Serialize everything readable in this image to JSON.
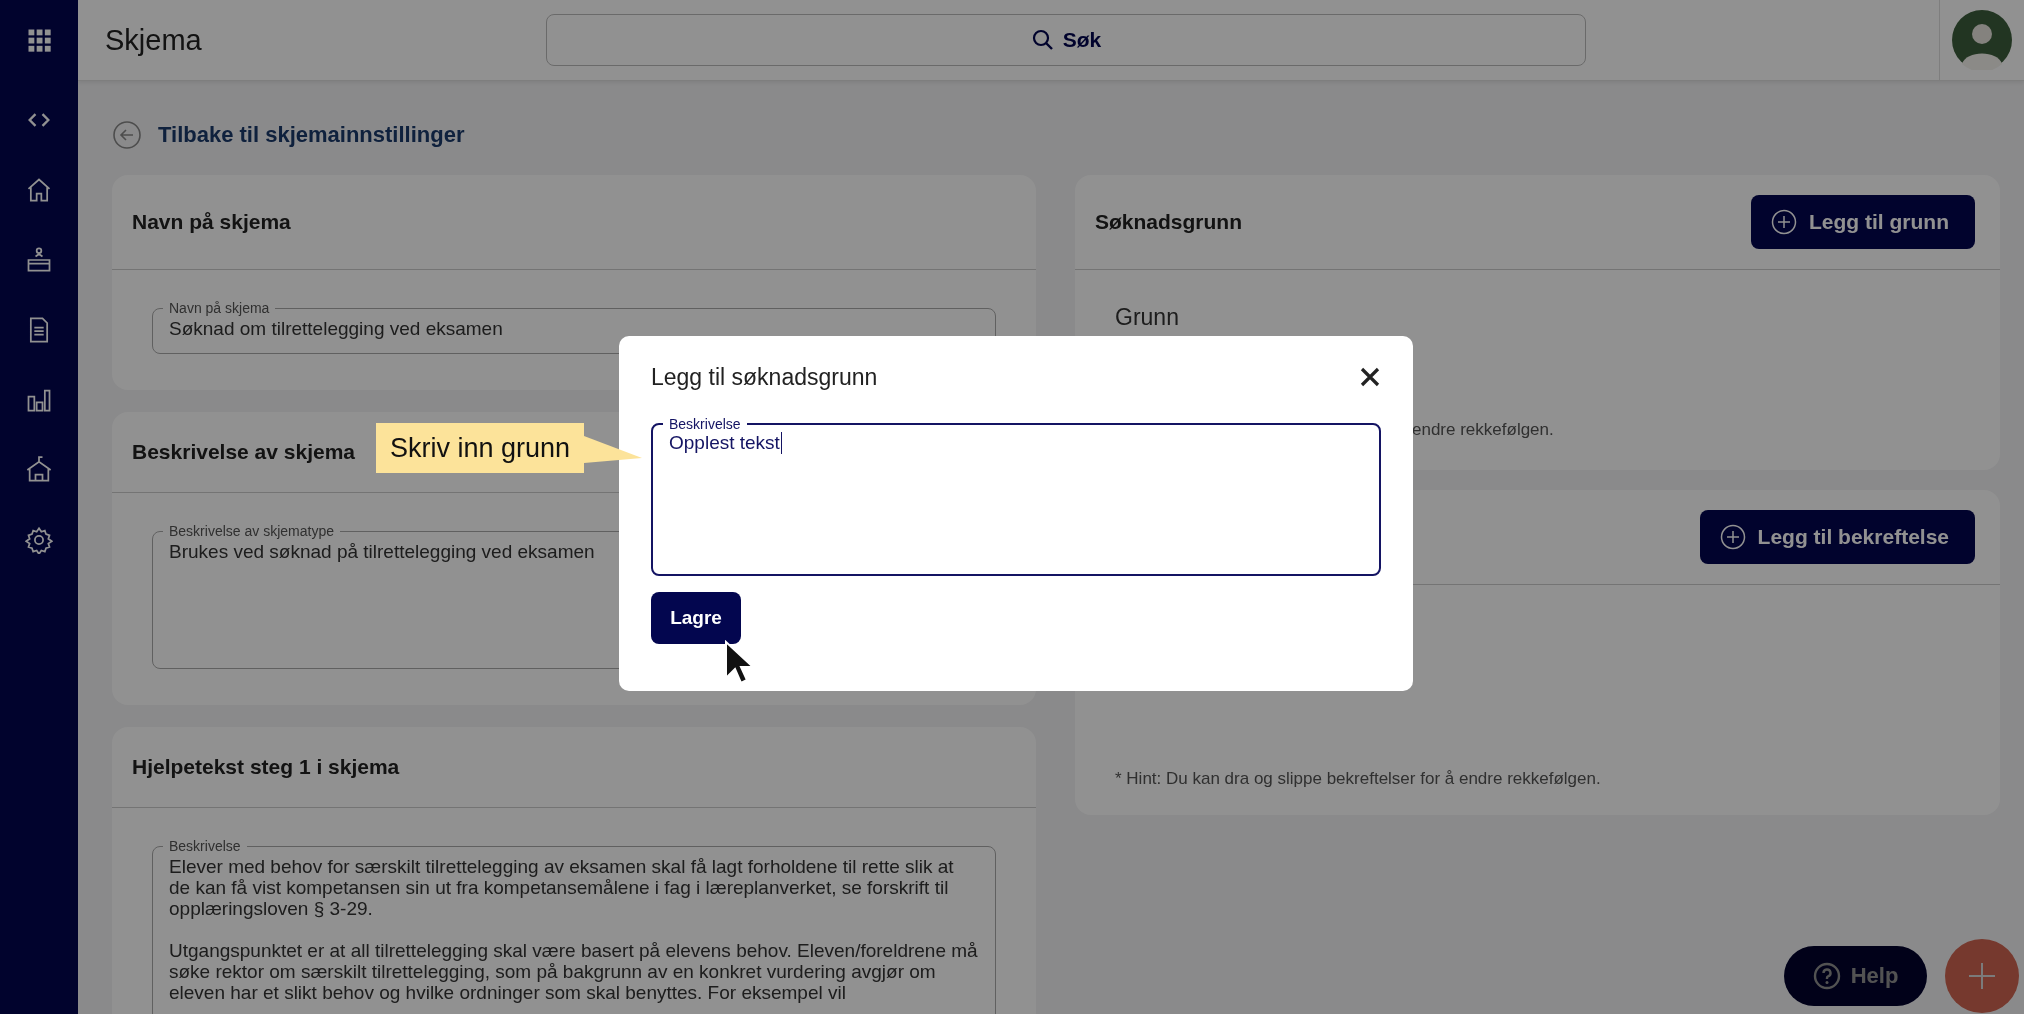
{
  "topbar": {
    "title": "Skjema",
    "search": {
      "placeholder": "Søk"
    }
  },
  "back_link": "Tilbake til skjemainnstillinger",
  "left_cards": [
    {
      "title": "Navn på skjema",
      "field": {
        "label": "Navn på skjema",
        "value": "Søknad om tilrettelegging ved eksamen",
        "kind": "line"
      }
    },
    {
      "title": "Beskrivelse av skjema",
      "field": {
        "label": "Beskrivelse av skjematype",
        "value": "Brukes ved søknad på tilrettelegging ved eksamen",
        "kind": "area"
      }
    },
    {
      "title": "Hjelpetekst steg 1 i skjema",
      "field": {
        "label": "Beskrivelse",
        "value": "Elever med behov for særskilt tilrettelegging av eksamen skal få lagt forholdene til rette slik at\nde kan få vist kompetansen sin ut fra kompetansemålene i fag i læreplanverket, se forskrift til\nopplæringsloven § 3-29.\n\nUtgangspunktet er at all tilrettelegging skal være basert på elevens behov. Eleven/foreldrene må\nsøke rektor om særskilt tilrettelegging, som på bakgrunn av en konkret vurdering avgjør om\neleven har et slikt behov og hvilke ordninger som skal benyttes. For eksempel vil",
        "kind": "long"
      }
    }
  ],
  "right_cards": [
    {
      "title": "Søknadsgrunn",
      "button": "Legg til grunn",
      "items": [
        "Grunn"
      ],
      "hint": "endre rekkefølgen."
    },
    {
      "button": "Legg til bekreftelse",
      "hint": "* Hint: Du kan dra og slippe bekreftelser for å endre rekkefølgen."
    }
  ],
  "dialog": {
    "title": "Legg til søknadsgrunn",
    "field": {
      "label": "Beskrivelse",
      "value": "Opplest tekst"
    },
    "save": "Lagre"
  },
  "callout": {
    "text": "Skriv inn grunn"
  },
  "help": "Help"
}
